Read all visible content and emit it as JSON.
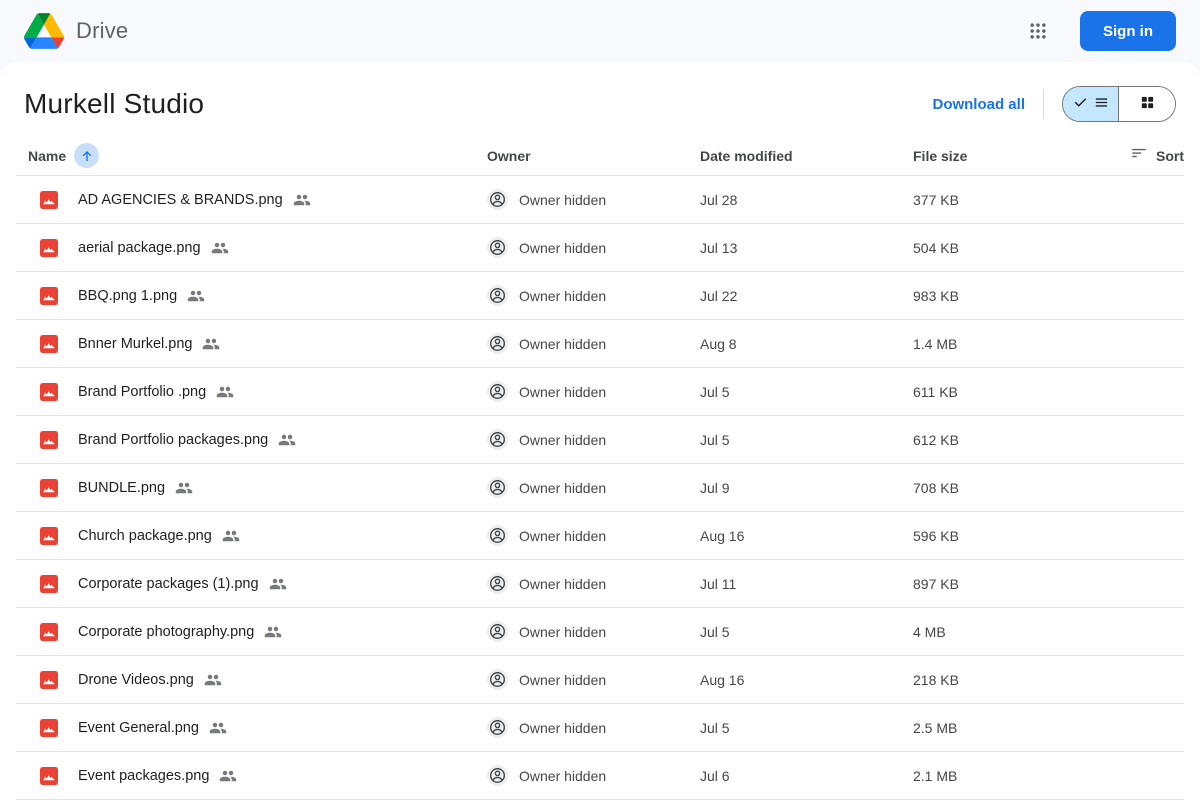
{
  "topbar": {
    "app_name": "Drive",
    "sign_in_label": "Sign in"
  },
  "header": {
    "title": "Murkell Studio",
    "download_all_label": "Download all"
  },
  "view_toggle": {
    "selected": "list",
    "options": [
      "list",
      "grid"
    ]
  },
  "table": {
    "columns": {
      "name": "Name",
      "owner": "Owner",
      "date_modified": "Date modified",
      "file_size": "File size",
      "sort": "Sort"
    },
    "owner_hidden_label": "Owner hidden",
    "sort_direction": "ascending",
    "rows": [
      {
        "name": "AD AGENCIES & BRANDS.png",
        "date_modified": "Jul 28",
        "file_size": "377 KB",
        "shared": true
      },
      {
        "name": "aerial package.png",
        "date_modified": "Jul 13",
        "file_size": "504 KB",
        "shared": true
      },
      {
        "name": "BBQ.png 1.png",
        "date_modified": "Jul 22",
        "file_size": "983 KB",
        "shared": true
      },
      {
        "name": "Bnner Murkel.png",
        "date_modified": "Aug 8",
        "file_size": "1.4 MB",
        "shared": true
      },
      {
        "name": "Brand Portfolio .png",
        "date_modified": "Jul 5",
        "file_size": "611 KB",
        "shared": true
      },
      {
        "name": "Brand Portfolio packages.png",
        "date_modified": "Jul 5",
        "file_size": "612 KB",
        "shared": true
      },
      {
        "name": "BUNDLE.png",
        "date_modified": "Jul 9",
        "file_size": "708 KB",
        "shared": true
      },
      {
        "name": "Church package.png",
        "date_modified": "Aug 16",
        "file_size": "596 KB",
        "shared": true
      },
      {
        "name": "Corporate packages (1).png",
        "date_modified": "Jul 11",
        "file_size": "897 KB",
        "shared": true
      },
      {
        "name": "Corporate photography.png",
        "date_modified": "Jul 5",
        "file_size": "4 MB",
        "shared": true
      },
      {
        "name": "Drone Videos.png",
        "date_modified": "Aug 16",
        "file_size": "218 KB",
        "shared": true
      },
      {
        "name": "Event General.png",
        "date_modified": "Jul 5",
        "file_size": "2.5 MB",
        "shared": true
      },
      {
        "name": "Event packages.png",
        "date_modified": "Jul 6",
        "file_size": "2.1 MB",
        "shared": true
      }
    ]
  },
  "icons": {
    "brand": "google-drive-triangle-logo",
    "apps": "apps-grid-icon",
    "list_view": "checkmark-and-list-icon",
    "grid_view": "grid-view-icon",
    "name_sort": "arrow-up-icon",
    "sort": "sort-lines-icon",
    "file": "image-file-icon",
    "shared": "people-shared-icon",
    "owner": "person-circle-icon"
  },
  "colors": {
    "accent_blue": "#1a73e8",
    "toggle_selected_bg": "#c2e7ff",
    "file_icon_red": "#ea4335",
    "topbar_bg": "#f8f9fc",
    "row_border": "#e1e3e6"
  }
}
